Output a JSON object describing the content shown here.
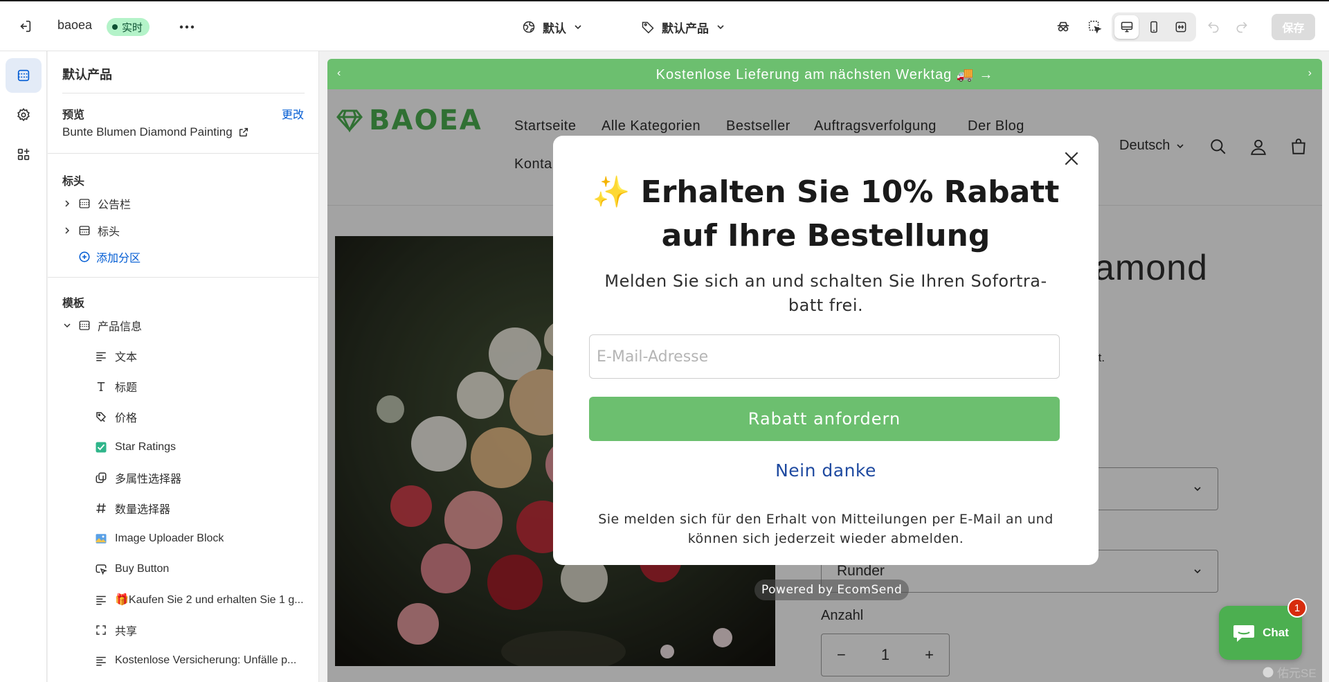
{
  "topbar": {
    "store_name": "baoea",
    "status_badge": "实时",
    "theme_select": "默认",
    "template_select": "默认产品",
    "save_label": "保存"
  },
  "panel": {
    "title": "默认产品",
    "preview_label": "预览",
    "change_link": "更改",
    "preview_product": "Bunte Blumen Diamond Painting",
    "header_group_label": "标头",
    "header_sections": [
      {
        "label": "公告栏",
        "icon": "section-layout-icon"
      },
      {
        "label": "标头",
        "icon": "header-layout-icon"
      }
    ],
    "add_section": "添加分区",
    "template_group_label": "模板",
    "template_section": {
      "label": "产品信息",
      "icon": "section-layout-icon"
    },
    "blocks": [
      {
        "label": "文本",
        "icon": "text-lines-icon"
      },
      {
        "label": "标题",
        "icon": "title-t-icon"
      },
      {
        "label": "价格",
        "icon": "price-tag-icon"
      },
      {
        "label": "Star Ratings",
        "icon": "star-ratings-app-icon"
      },
      {
        "label": "多属性选择器",
        "icon": "variant-picker-icon"
      },
      {
        "label": "数量选择器",
        "icon": "hash-icon"
      },
      {
        "label": "Image Uploader Block",
        "icon": "image-uploader-app-icon"
      },
      {
        "label": "Buy Button",
        "icon": "buy-button-cursor-icon"
      },
      {
        "label": "🎁Kaufen Sie 2 und erhalten Sie 1 g...",
        "icon": "text-lines-icon"
      },
      {
        "label": "共享",
        "icon": "share-frame-icon"
      },
      {
        "label": "Kostenlose Versicherung: Unfälle p...",
        "icon": "text-lines-icon"
      }
    ]
  },
  "store": {
    "announcement": "Kostenlose Lieferung am nächsten Werktag 🚚 →",
    "logo": "BAOEA",
    "nav": [
      "Startseite",
      "Alle Kategorien",
      "Bestseller",
      "Auftragsverfolgung",
      "Der Blog",
      "Konta"
    ],
    "language": "Deutsch",
    "product_title_fragment": "amond",
    "tax_fragment": "wSt.",
    "shape_value": "Runder",
    "quantity_label": "Anzahl",
    "quantity_value": "1"
  },
  "popup": {
    "heading": "✨ Erhalten Sie 10% Rabatt auf Ihre Bestellung",
    "subheading": "Melden Sie sich an und schalten Sie Ihren Sofortra-batt frei.",
    "email_placeholder": "E-Mail-Adresse",
    "submit": "Rabatt anfordern",
    "decline": "Nein danke",
    "legal": "Sie melden sich für den Erhalt von Mitteilungen per E-Mail an und können sich jederzeit wieder abmelden.",
    "powered_by": "Powered by EcomSend"
  },
  "chat": {
    "label": "Chat",
    "badge": "1"
  },
  "watermark": "佑元SE",
  "colors": {
    "brand_green": "#6cbf6f",
    "link_blue": "#005bd3",
    "live_badge": "#b4f3c9"
  }
}
